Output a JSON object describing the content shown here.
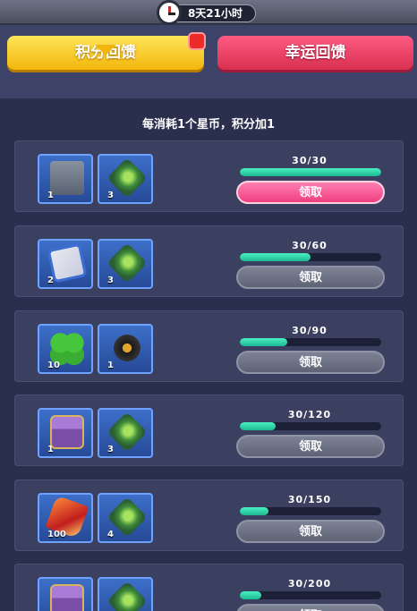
{
  "timer": {
    "text": "8天21小时"
  },
  "tabs": {
    "points": "积分回馈",
    "lucky": "幸运回馈"
  },
  "subtitle": "每消耗1个星币，积分加1",
  "rows": [
    {
      "items": [
        {
          "icon": "machine-icon",
          "count": "1"
        },
        {
          "icon": "tank-icon",
          "count": "3"
        }
      ],
      "progress_text": "30/30",
      "progress": 1.0,
      "claim_label": "领取",
      "claim_active": true
    },
    {
      "items": [
        {
          "icon": "ticket-icon",
          "count": "2"
        },
        {
          "icon": "tank-icon",
          "count": "3"
        }
      ],
      "progress_text": "30/60",
      "progress": 0.5,
      "claim_label": "领取",
      "claim_active": false
    },
    {
      "items": [
        {
          "icon": "clover-icon",
          "count": "10"
        },
        {
          "icon": "gear-icon",
          "count": "1"
        }
      ],
      "progress_text": "30/90",
      "progress": 0.333,
      "claim_label": "领取",
      "claim_active": false
    },
    {
      "items": [
        {
          "icon": "chest-icon",
          "count": "1"
        },
        {
          "icon": "tank-icon",
          "count": "3"
        }
      ],
      "progress_text": "30/120",
      "progress": 0.25,
      "claim_label": "领取",
      "claim_active": false
    },
    {
      "items": [
        {
          "icon": "gem-icon",
          "count": "100"
        },
        {
          "icon": "tank-icon",
          "count": "4"
        }
      ],
      "progress_text": "30/150",
      "progress": 0.2,
      "claim_label": "领取",
      "claim_active": false
    },
    {
      "items": [
        {
          "icon": "chest-icon",
          "count": ""
        },
        {
          "icon": "tank-icon",
          "count": ""
        }
      ],
      "progress_text": "30/200",
      "progress": 0.15,
      "claim_label": "领取",
      "claim_active": false
    }
  ]
}
